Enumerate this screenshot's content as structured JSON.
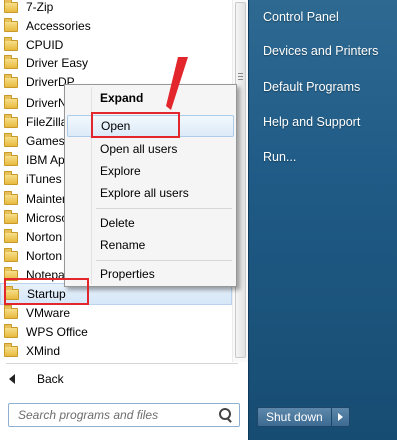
{
  "programs": [
    {
      "label": "7-Zip"
    },
    {
      "label": "Accessories"
    },
    {
      "label": "CPUID"
    },
    {
      "label": "Driver Easy"
    },
    {
      "label": "DriverDP"
    },
    {
      "label": "DriverNa"
    },
    {
      "label": "FileZilla"
    },
    {
      "label": "Games"
    },
    {
      "label": "IBM App"
    },
    {
      "label": "iTunes"
    },
    {
      "label": "Mainter"
    },
    {
      "label": "Microso"
    },
    {
      "label": "Norton"
    },
    {
      "label": "Norton"
    },
    {
      "label": "Notepad"
    },
    {
      "label": "Startup"
    },
    {
      "label": "VMware"
    },
    {
      "label": "WPS Office"
    },
    {
      "label": "XMind"
    }
  ],
  "back_label": "Back",
  "search": {
    "placeholder": "Search programs and files"
  },
  "right_pane": {
    "items": [
      {
        "label": "Control Panel"
      },
      {
        "label": "Devices and Printers"
      },
      {
        "label": "Default Programs"
      },
      {
        "label": "Help and Support"
      },
      {
        "label": "Run..."
      }
    ],
    "shutdown_label": "Shut down"
  },
  "context_menu": {
    "items": [
      {
        "label": "Expand"
      },
      {
        "label": "Open"
      },
      {
        "label": "Open all users"
      },
      {
        "label": "Explore"
      },
      {
        "label": "Explore all users"
      },
      {
        "label": "Delete"
      },
      {
        "label": "Rename"
      },
      {
        "label": "Properties"
      }
    ]
  },
  "colors": {
    "accent_red": "#e3262c",
    "right_pane_bg": "#1f5b86",
    "selection_bg": "#d6e7f8"
  }
}
